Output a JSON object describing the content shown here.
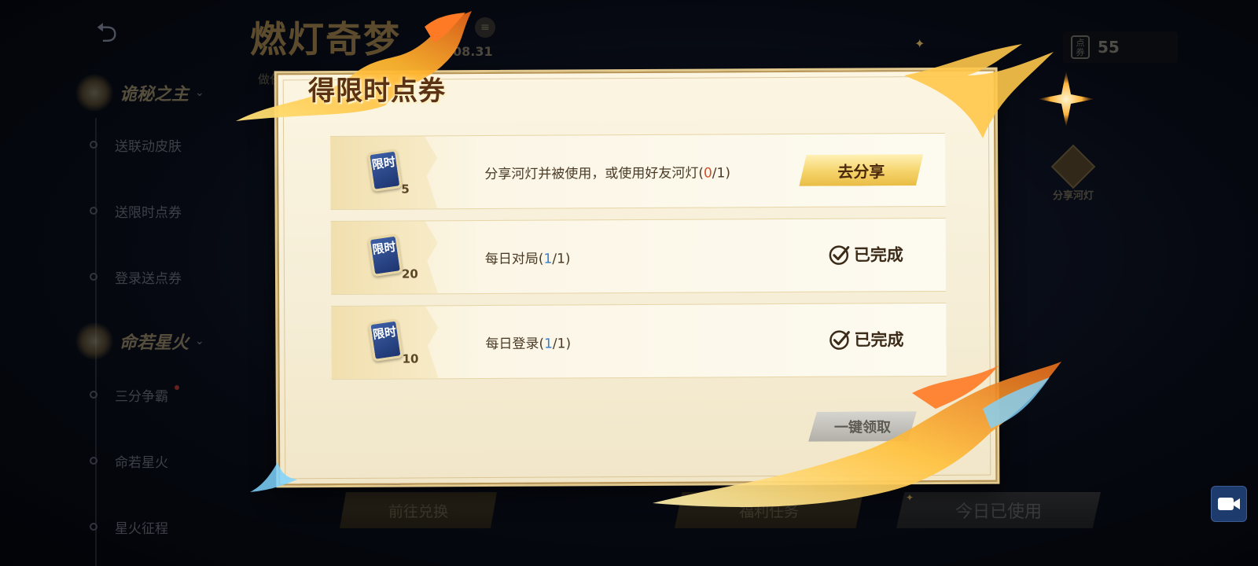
{
  "background": {
    "back_label": "⮌",
    "event_title": "燃灯奇梦",
    "event_date": "08.31",
    "event_subtitle": "做任务",
    "sidebar": {
      "group_1": "诡秘之主",
      "group_1_items": [
        "送联动皮肤",
        "送限时点券",
        "登录送点券"
      ],
      "group_2": "命若星火",
      "group_2_items": [
        "三分争霸",
        "命若星火",
        "星火征程"
      ]
    },
    "currency_amount": "55",
    "currency_icon_text": "点券",
    "share_lamp_label": "分享河灯",
    "bottom_buttons": [
      "前往兑换",
      "福利任务",
      "今日已使用"
    ]
  },
  "dialog": {
    "title": "得限时点券",
    "ticket_icon_text": "限时",
    "tasks": [
      {
        "count": "5",
        "desc": "分享河灯并被使用，或使用好友河灯",
        "progress_open": "(",
        "progress_value": "0",
        "progress_rest": "/1)",
        "action": "去分享"
      },
      {
        "count": "20",
        "desc": "每日对局",
        "progress_open": "(",
        "progress_value": "1",
        "progress_rest": "/1)",
        "action": "已完成"
      },
      {
        "count": "10",
        "desc": "每日登录",
        "progress_open": "(",
        "progress_value": "1",
        "progress_rest": "/1)",
        "action": "已完成"
      }
    ],
    "claim_all_label": "一键领取"
  },
  "colors": {
    "progress_incomplete": "#d2502e",
    "progress_complete": "#3e7fc9",
    "gold_button": "#f5d36a",
    "dialog_bg": "#fbf5e2"
  },
  "icons": {
    "check": "check-circle-icon",
    "ticket": "ticket-icon",
    "record": "video-record-icon"
  }
}
